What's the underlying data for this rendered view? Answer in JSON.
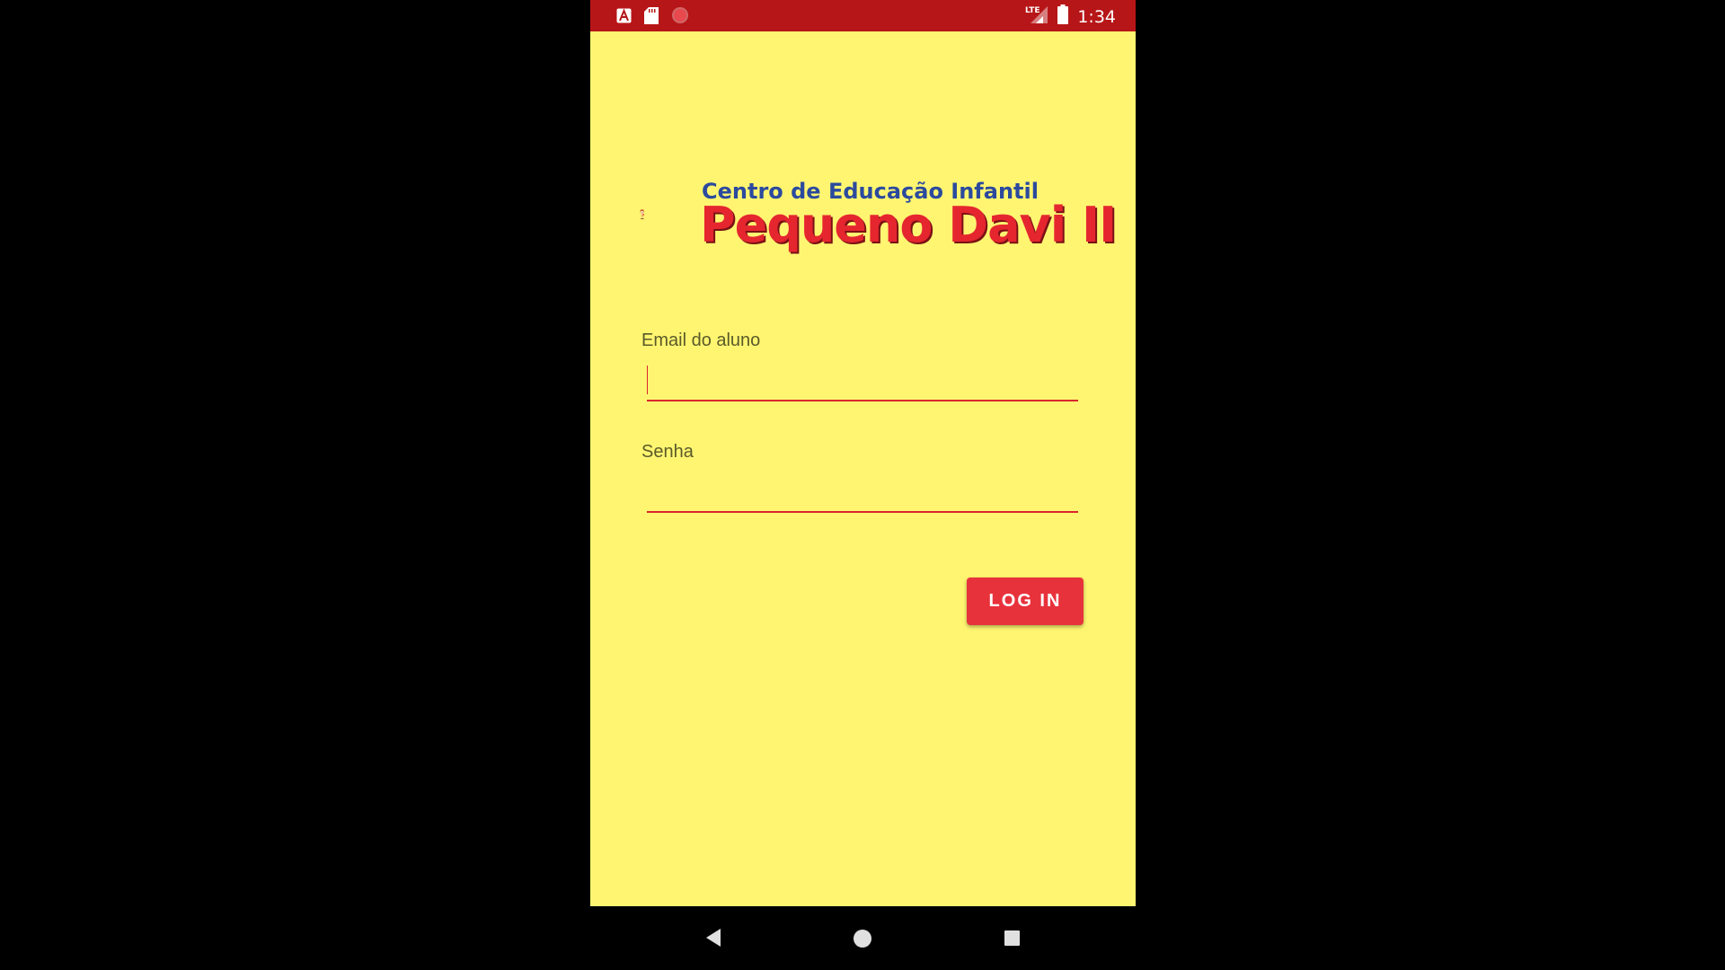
{
  "status_bar": {
    "time": "1:34",
    "network": "LTE",
    "left_icons": [
      "font-a-icon",
      "sd-card-icon",
      "record-icon"
    ],
    "right_icons": [
      "lte-signal-icon",
      "battery-icon"
    ],
    "background": "#b71618"
  },
  "logo": {
    "subtitle": "Centro de Educação Infantil",
    "title": "Pequeno Davi II"
  },
  "form": {
    "email_label": "Email do aluno",
    "email_value": "",
    "password_label": "Senha",
    "password_value": "",
    "login_label": "LOG IN"
  },
  "nav_bar": {
    "buttons": [
      "back-icon",
      "home-icon",
      "recents-icon"
    ]
  },
  "colors": {
    "screen_background": "#fff571",
    "accent": "#e8323b",
    "logo_blue": "#2b4a9e"
  }
}
